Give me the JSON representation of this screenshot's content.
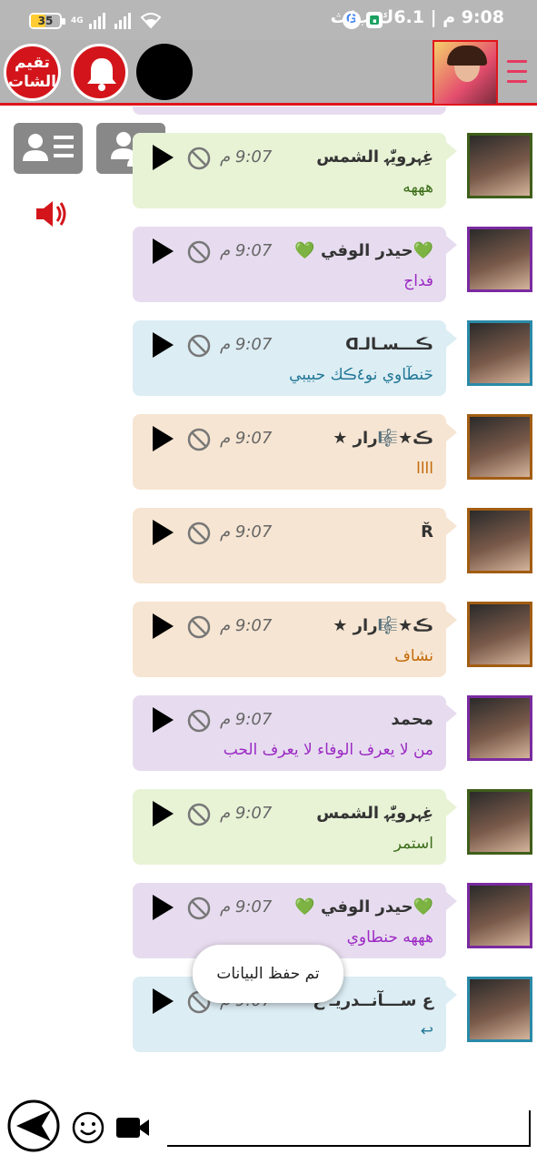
{
  "status_bar": {
    "time": "9:08",
    "carrier": "6.1ك.ب/ث",
    "am_pm": "م |",
    "battery": "35",
    "network": "4G"
  },
  "toolbar": {
    "rate_line1": "تقيم",
    "rate_line2": "الشات"
  },
  "messages": [
    {
      "name": "",
      "time": "",
      "text": "فداج",
      "color": "purple",
      "avatar_border": "#7a2aa0"
    },
    {
      "name": "ﻏِﮩﺮوﯾّٰﮩ الشمس",
      "time": "9:07 م",
      "text": "هههه",
      "color": "green",
      "avatar_border": "#3f5e1a"
    },
    {
      "name": "💚حيدر الوفي 💚",
      "time": "9:07 م",
      "text": "فداج",
      "color": "purple",
      "avatar_border": "#7a2aa0"
    },
    {
      "name": "ڪـــسـالـᗡ",
      "time": "9:07 م",
      "text": "حٓنطٓاوي نو٤ڪك حبيبي",
      "color": "blue",
      "avatar_border": "#2a8aa8"
    },
    {
      "name": "ڪ★🎼رار ★",
      "time": "9:07 م",
      "text": "اااا",
      "color": "tan",
      "avatar_border": "#a25d13"
    },
    {
      "name": "Ř",
      "time": "9:07 م",
      "text": "",
      "color": "tan",
      "avatar_border": "#a25d13"
    },
    {
      "name": "ڪ★🎼رار ★",
      "time": "9:07 م",
      "text": "نشاف",
      "color": "tan",
      "avatar_border": "#a25d13"
    },
    {
      "name": "محمد",
      "time": "9:07 م",
      "text": "من لا يعرف الوفاء لا يعرف الحب",
      "color": "purple",
      "avatar_border": "#7a2aa0"
    },
    {
      "name": "ﻏِﮩﺮوﯾّٰﮩ الشمس",
      "time": "9:07 م",
      "text": "استمر",
      "color": "green",
      "avatar_border": "#3f5e1a"
    },
    {
      "name": "💚حيدر الوفي 💚",
      "time": "9:07 م",
      "text": "هههه حنطاوي",
      "color": "purple",
      "avatar_border": "#7a2aa0"
    },
    {
      "name": "ﻉ ﺳـــآنــدريـ ﻉ",
      "time": "9:07 م",
      "text": "↩",
      "color": "blue",
      "avatar_border": "#2a8aa8"
    }
  ],
  "toast": "تم حفظ البيانات",
  "composer": {
    "value": "",
    "placeholder": ""
  },
  "colors": {
    "accent_red": "#d3151b",
    "toolbar_gray": "#b4b4b4"
  },
  "icons": [
    "menu-icon",
    "bell-icon",
    "users-icon",
    "user-list-icon",
    "speaker-icon",
    "play-icon",
    "ban-icon",
    "send-icon",
    "emoji-icon",
    "video-icon"
  ]
}
